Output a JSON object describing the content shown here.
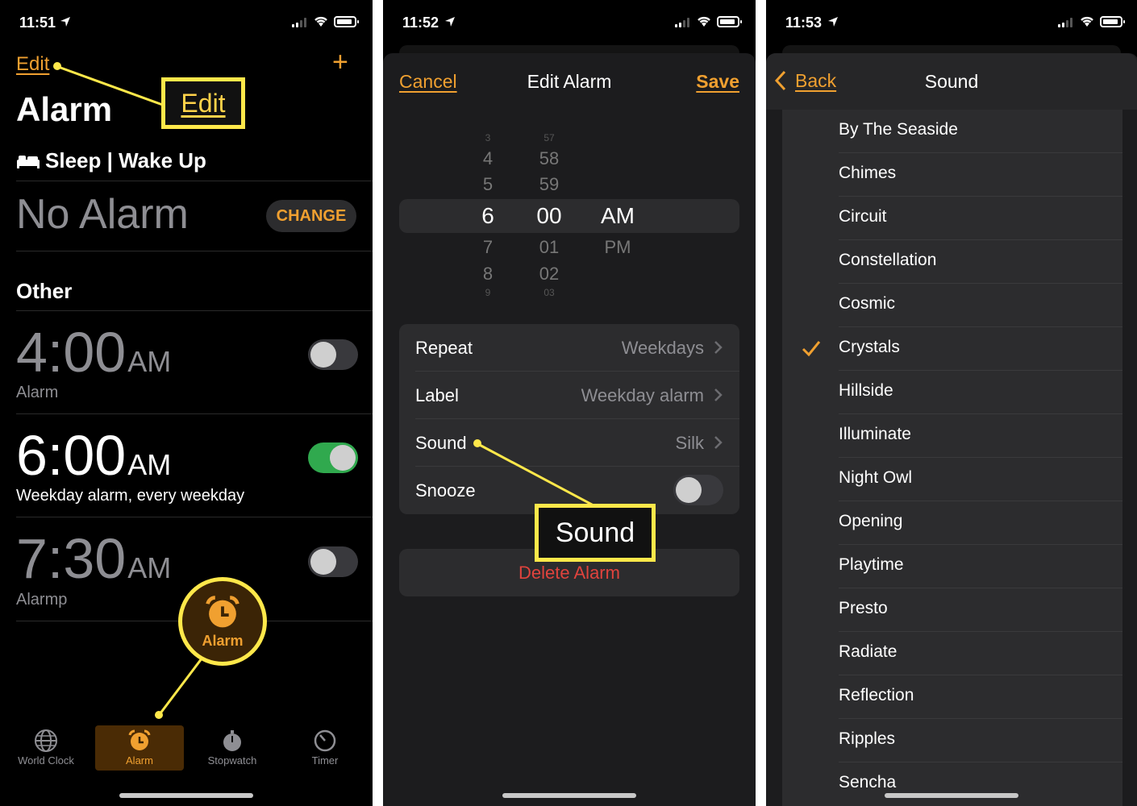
{
  "screen1": {
    "status_time": "11:51",
    "edit_label": "Edit",
    "add_symbol": "+",
    "title": "Alarm",
    "sleep_header": "Sleep | Wake Up",
    "no_alarm": "No Alarm",
    "change_label": "CHANGE",
    "other_header": "Other",
    "alarms": [
      {
        "time": "4:00",
        "ampm": "AM",
        "label": "Alarm",
        "enabled": false
      },
      {
        "time": "6:00",
        "ampm": "AM",
        "label": "Weekday alarm, every weekday",
        "enabled": true
      },
      {
        "time": "7:30",
        "ampm": "AM",
        "label": "Alarmp",
        "enabled": false
      }
    ],
    "tabs": [
      {
        "label": "World Clock",
        "icon": "globe-icon"
      },
      {
        "label": "Alarm",
        "icon": "alarm-clock-icon"
      },
      {
        "label": "Stopwatch",
        "icon": "stopwatch-icon"
      },
      {
        "label": "Timer",
        "icon": "timer-icon"
      }
    ],
    "active_tab": "Alarm",
    "callout_edit": "Edit",
    "callout_alarm": "Alarm"
  },
  "screen2": {
    "status_time": "11:52",
    "cancel_label": "Cancel",
    "title": "Edit Alarm",
    "save_label": "Save",
    "picker": {
      "hours": [
        "3",
        "4",
        "5",
        "6",
        "7",
        "8",
        "9"
      ],
      "minutes": [
        "57",
        "58",
        "59",
        "00",
        "01",
        "02",
        "03"
      ],
      "periods": [
        "AM",
        "PM"
      ],
      "selected": {
        "hour": "6",
        "minute": "00",
        "period": "AM"
      }
    },
    "rows": [
      {
        "label": "Repeat",
        "value": "Weekdays"
      },
      {
        "label": "Label",
        "value": "Weekday alarm"
      },
      {
        "label": "Sound",
        "value": "Silk"
      },
      {
        "label": "Snooze",
        "value": ""
      }
    ],
    "snooze_enabled": false,
    "delete_label": "Delete Alarm",
    "callout_sound": "Sound"
  },
  "screen3": {
    "status_time": "11:53",
    "back_label": "Back",
    "title": "Sound",
    "sounds": [
      "By The Seaside",
      "Chimes",
      "Circuit",
      "Constellation",
      "Cosmic",
      "Crystals",
      "Hillside",
      "Illuminate",
      "Night Owl",
      "Opening",
      "Playtime",
      "Presto",
      "Radiate",
      "Reflection",
      "Ripples",
      "Sencha"
    ],
    "selected_sound": "Crystals"
  },
  "colors": {
    "accent": "#f0a030",
    "callout": "#ffe84a",
    "toggle_on": "#30a94e",
    "destructive": "#e0433d"
  }
}
